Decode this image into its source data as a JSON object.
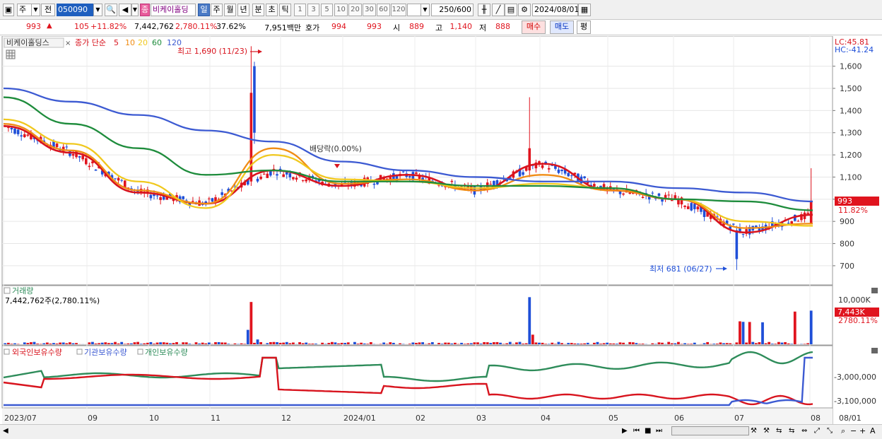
{
  "toolbar": {
    "period_label": "주",
    "prev_label": "전",
    "stock_code": "050090",
    "stock_name_badge": "종",
    "stock_name": "비케이홀딩",
    "tabs": [
      "일",
      "주",
      "월",
      "년",
      "분",
      "초",
      "틱"
    ],
    "active_tab": "일",
    "intervals": [
      "1",
      "3",
      "5",
      "10",
      "20",
      "30",
      "60",
      "120"
    ],
    "count_display": "250",
    "count_total": "/600",
    "date": "2024/08/01"
  },
  "quote": {
    "price": "993",
    "change_arrow": "▲",
    "change": "105",
    "change_pct": "+11.82%",
    "volume": "7,442,762",
    "volume_pct": "2,780.11%",
    "turnover": "37.62%",
    "amount": "7,951백만",
    "hoga_label": "호가",
    "ask": "994",
    "bid": "993",
    "open_label": "시",
    "open": "889",
    "high_label": "고",
    "high": "1,140",
    "low_label": "저",
    "low": "888",
    "buy_label": "매수",
    "sell_label": "매도",
    "avg_label": "평"
  },
  "price_pane": {
    "title": "비케이홀딩스",
    "ma_label": "종가 단순",
    "ma_periods": [
      "5",
      "10",
      "20",
      "60",
      "120"
    ],
    "lc_label": "LC:45.81",
    "hc_label": "HC:-41.24",
    "current_price_tag": "993",
    "current_change_tag": "11.82%",
    "high_annotation": "최고 1,690 (11/23)",
    "low_annotation": "최저 681 (06/27)",
    "dividend_annotation": "배당락(0.00%)"
  },
  "volume_pane": {
    "title": "거래량",
    "value_label": "7,442,762주(2,780.11%)",
    "axis_label": "10,000K",
    "current_tag": "7,443K",
    "current_pct_tag": "2780.11%"
  },
  "holding_pane": {
    "legends": [
      "외국인보유수량",
      "기관보유수량",
      "개인보유수량"
    ],
    "axis_labels": [
      "-3,000,000",
      "-3,100,000"
    ]
  },
  "x_axis": {
    "labels": [
      "2023/07",
      "09",
      "10",
      "11",
      "12",
      "2024/01",
      "02",
      "03",
      "04",
      "05",
      "06",
      "07",
      "08",
      "08/01"
    ]
  },
  "colors": {
    "up": "#e0141e",
    "down": "#1f4fd8",
    "ma5": "#d8141e",
    "ma10": "#f08c14",
    "ma20": "#f0c81e",
    "ma60": "#1e8c3c",
    "ma120": "#3c5ad2",
    "foreign": "#d8141e",
    "institution": "#3c5ad2",
    "individual": "#2e8c5a"
  },
  "chart_data": {
    "type": "line",
    "title": "비케이홀딩스",
    "x": [
      "2023/07",
      "09",
      "10",
      "11",
      "12",
      "2024/01",
      "02",
      "03",
      "04",
      "05",
      "06",
      "07",
      "08"
    ],
    "y_ticks": [
      700,
      800,
      900,
      1000,
      1100,
      1200,
      1300,
      1400,
      1500,
      1600
    ],
    "ylim": [
      620,
      1720
    ],
    "series": [
      {
        "name": "5",
        "values": [
          1330,
          1210,
          1030,
          980,
          1130,
          1060,
          1110,
          1040,
          1160,
          1040,
          1000,
          850,
          930
        ]
      },
      {
        "name": "10",
        "values": [
          1340,
          1220,
          1040,
          980,
          1230,
          1070,
          1090,
          1040,
          1110,
          1040,
          1000,
          870,
          890
        ]
      },
      {
        "name": "20",
        "values": [
          1360,
          1250,
          1080,
          960,
          1200,
          1090,
          1080,
          1050,
          1070,
          1050,
          1000,
          900,
          880
        ]
      },
      {
        "name": "60",
        "values": [
          1460,
          1340,
          1230,
          1110,
          1130,
          1080,
          1080,
          1060,
          1060,
          1050,
          1000,
          990,
          950
        ]
      },
      {
        "name": "120",
        "values": [
          1500,
          1440,
          1380,
          1310,
          1260,
          1170,
          1130,
          1100,
          1080,
          1080,
          1050,
          1030,
          990
        ]
      }
    ]
  }
}
